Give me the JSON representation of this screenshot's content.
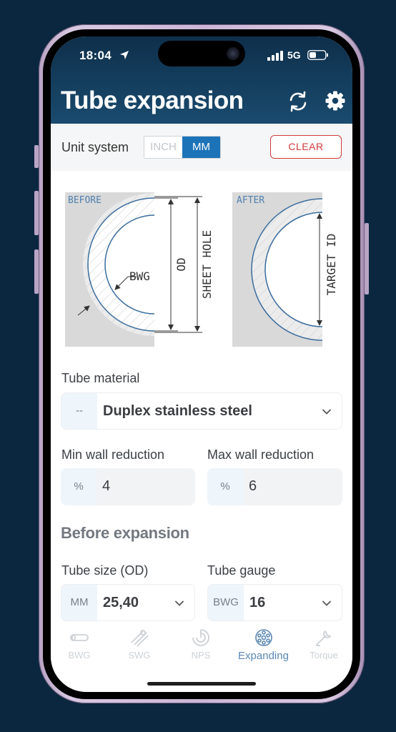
{
  "status": {
    "time": "18:04",
    "network": "5G"
  },
  "header": {
    "title": "Tube expansion"
  },
  "unit_system": {
    "label": "Unit system",
    "options": [
      "INCH",
      "MM"
    ],
    "selected": "MM",
    "clear_label": "CLEAR"
  },
  "diagram": {
    "before_label": "BEFORE",
    "after_label": "AFTER",
    "bwg_label": "BWG",
    "od_label": "OD",
    "sheet_hole_label": "SHEET HOLE",
    "target_id_label": "TARGET ID"
  },
  "material": {
    "label": "Tube material",
    "prefix": "--",
    "value": "Duplex stainless steel"
  },
  "min_wall": {
    "label": "Min wall reduction",
    "prefix": "%",
    "value": "4"
  },
  "max_wall": {
    "label": "Max wall reduction",
    "prefix": "%",
    "value": "6"
  },
  "before_expansion": {
    "title": "Before expansion",
    "tube_size": {
      "label": "Tube size (OD)",
      "prefix": "MM",
      "value": "25,40"
    },
    "tube_gauge": {
      "label": "Tube gauge",
      "prefix": "BWG",
      "value": "16"
    }
  },
  "tabs": [
    {
      "label": "BWG",
      "icon": "tube-icon"
    },
    {
      "label": "SWG",
      "icon": "wire-icon"
    },
    {
      "label": "NPS",
      "icon": "pipe-icon"
    },
    {
      "label": "Expanding",
      "icon": "expander-icon",
      "active": true
    },
    {
      "label": "Torque",
      "icon": "wrench-icon"
    }
  ],
  "colors": {
    "header": "#0e2f4b",
    "accent": "#1d73b8",
    "clear": "#d23a3a",
    "active_tab": "#5b87b4"
  }
}
